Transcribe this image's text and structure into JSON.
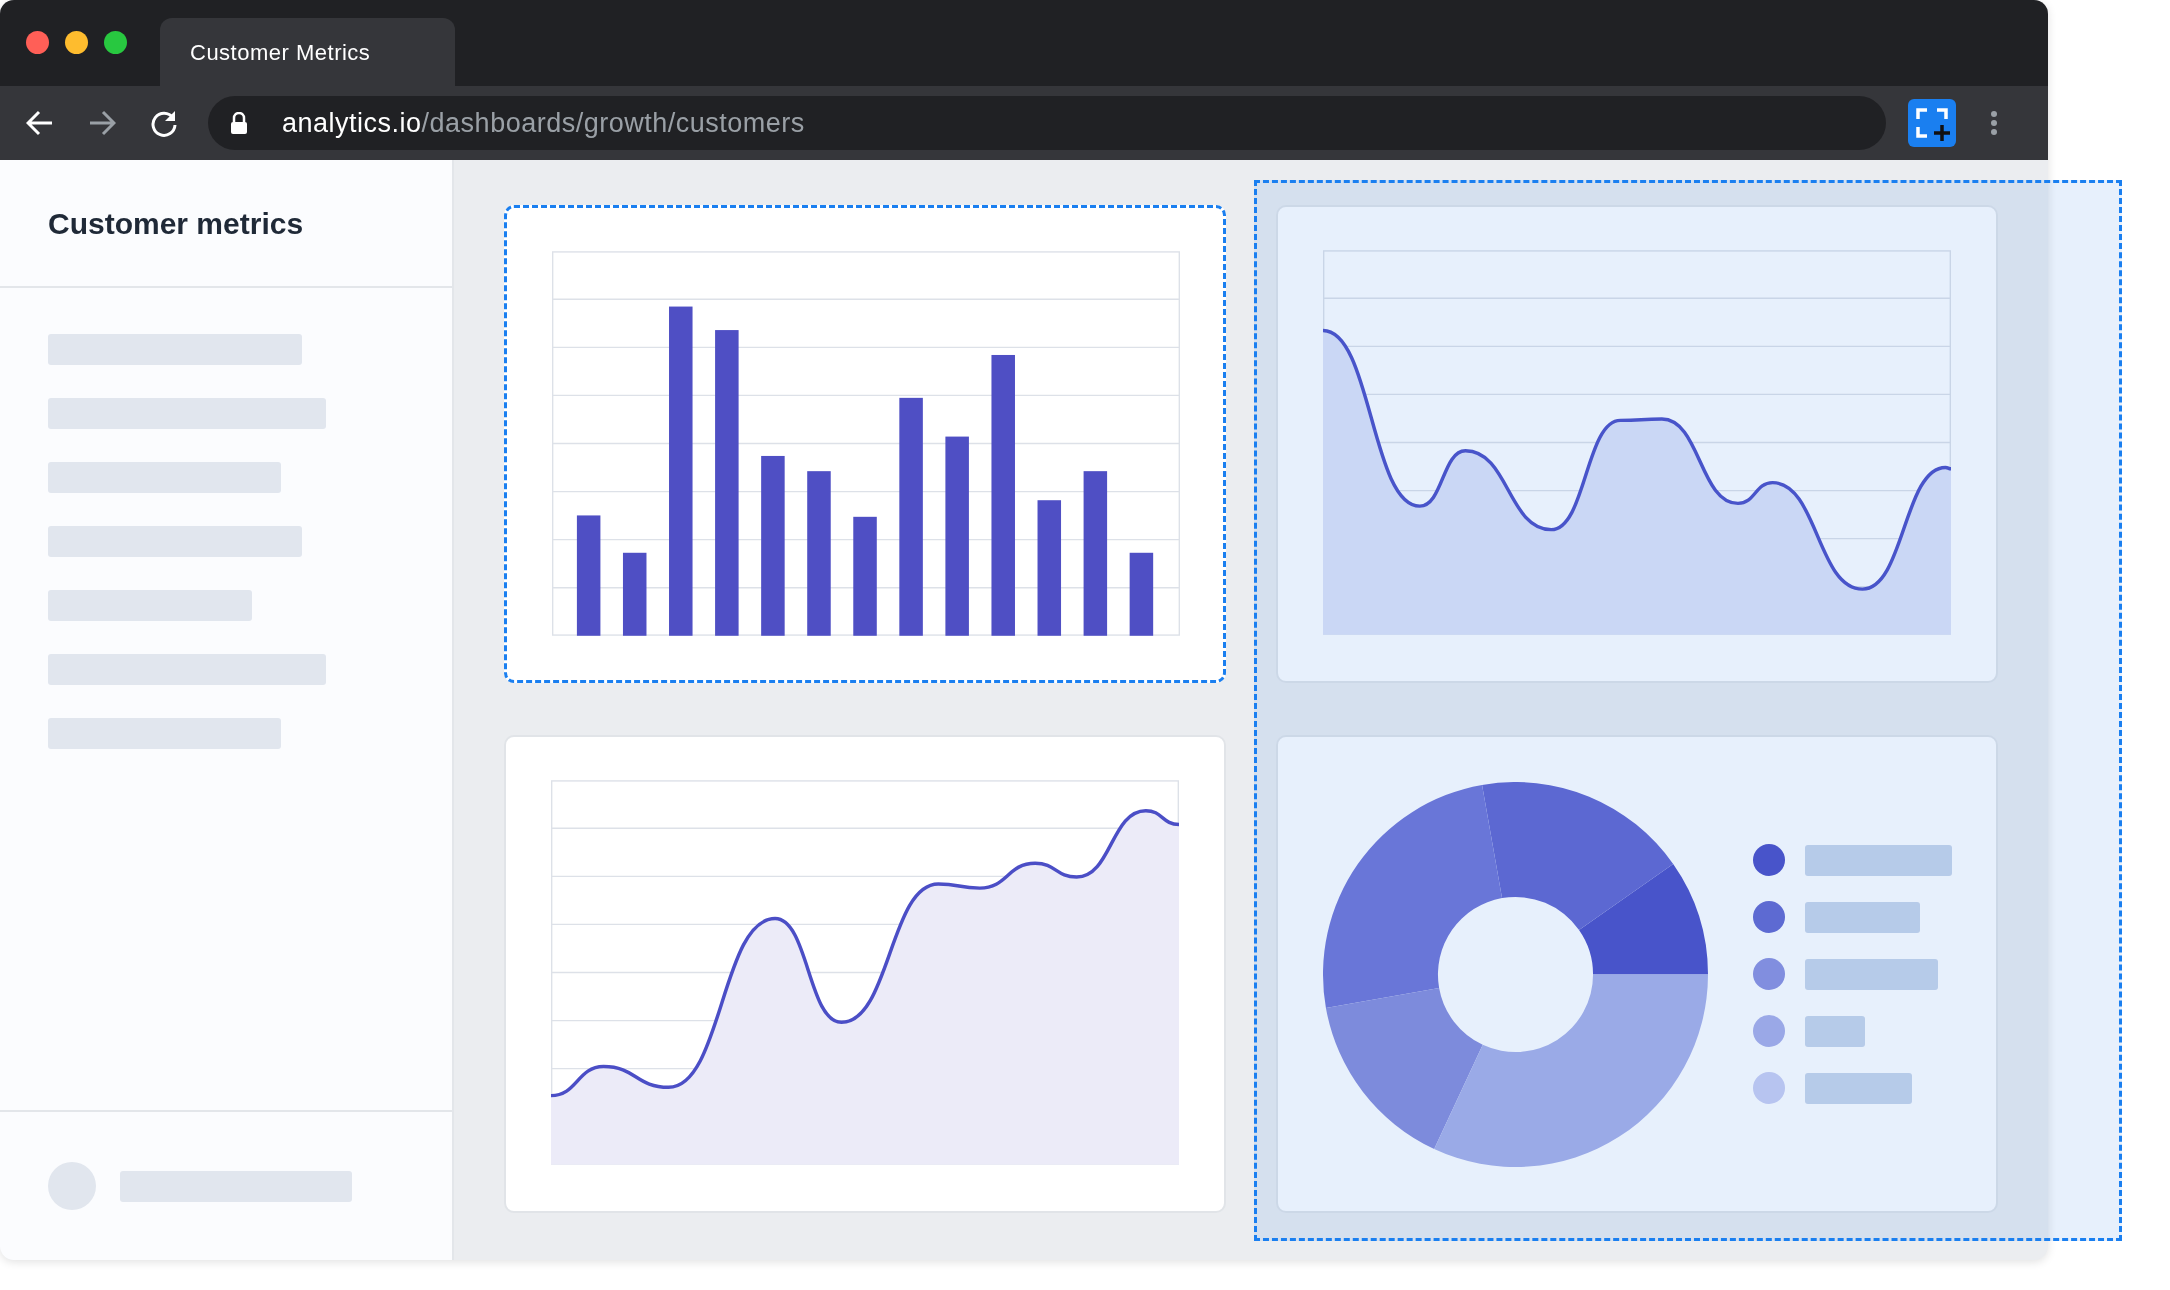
{
  "browser": {
    "tab_title": "Customer Metrics",
    "url_host": "analytics.io",
    "url_path": "/dashboards/growth/customers"
  },
  "sidebar": {
    "title": "Customer metrics"
  },
  "donut_legend": [
    {
      "color": "#4b4ec6"
    },
    {
      "color": "#6267d0"
    },
    {
      "color": "#8b90de"
    },
    {
      "color": "#a8aee8"
    },
    {
      "color": "#c9cdf2"
    }
  ]
}
